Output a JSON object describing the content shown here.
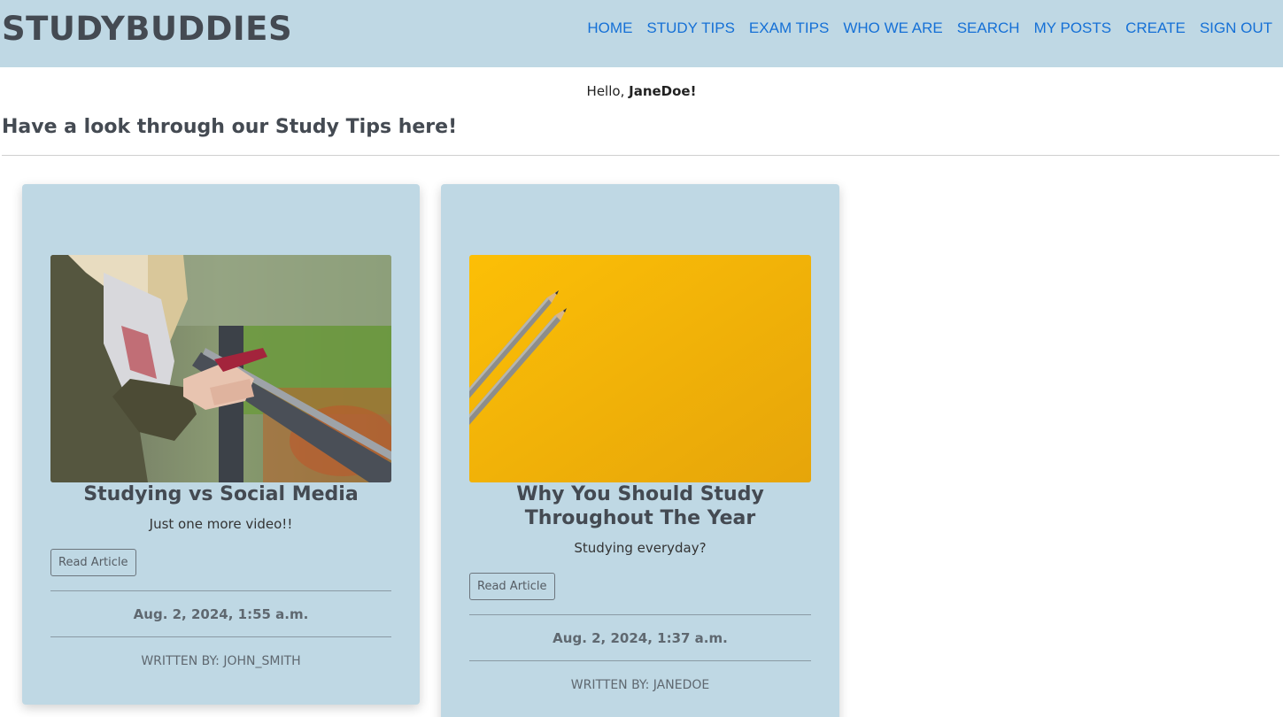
{
  "navbar": {
    "brand": "STUDYBUDDIES",
    "links": [
      "HOME",
      "STUDY TIPS",
      "EXAM TIPS",
      "WHO WE ARE",
      "SEARCH",
      "MY POSTS",
      "CREATE",
      "SIGN OUT"
    ],
    "background_color": "#bfd8e4",
    "link_color": "#1570d6"
  },
  "greeting": {
    "prefix": "Hello,",
    "username": "JaneDoe!"
  },
  "page": {
    "heading": "Have a look through our Study Tips here!"
  },
  "posts": [
    {
      "title": "Studying vs Social Media",
      "excerpt": "Just one more video!!",
      "button_label": "Read Article",
      "date": "Aug. 2, 2024, 1:55 a.m.",
      "author": "WRITTEN BY: JOHN_SMITH",
      "image": "person-holding-phone-photo"
    },
    {
      "title": "Why You Should Study Throughout The Year",
      "excerpt": "Studying everyday?",
      "button_label": "Read Article",
      "date": "Aug. 2, 2024, 1:37 a.m.",
      "author": "WRITTEN BY: JANEDOE",
      "image": "pencils-on-yellow-photo"
    }
  ]
}
